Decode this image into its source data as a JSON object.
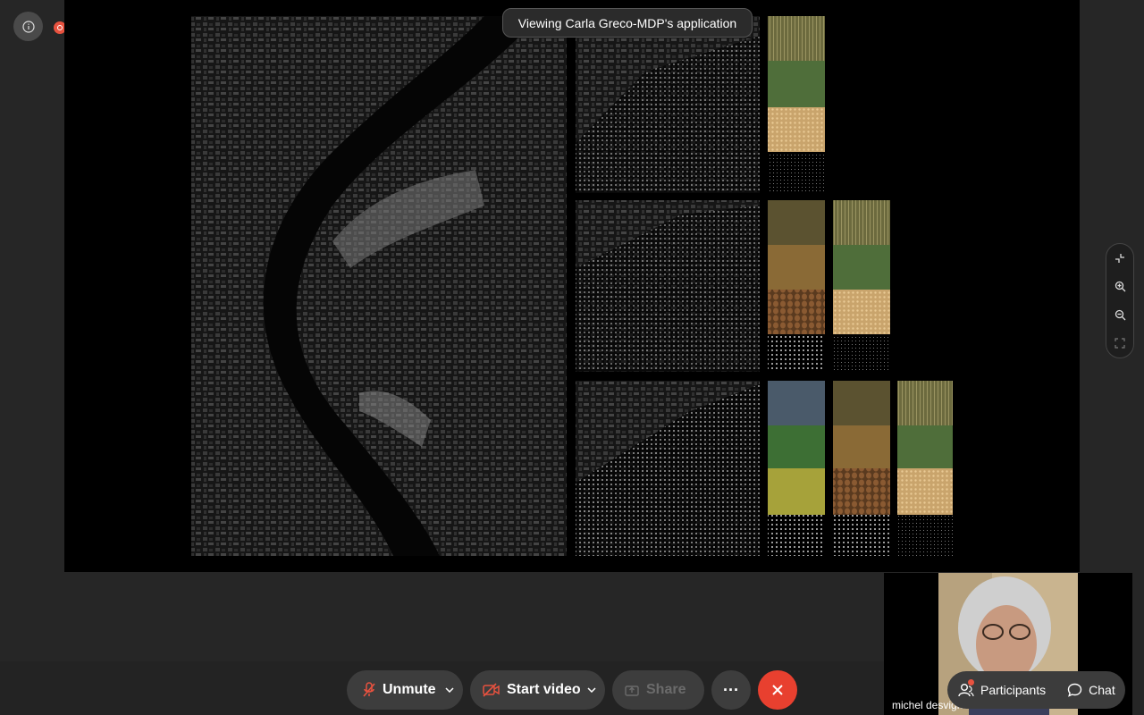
{
  "banner": {
    "text": "Viewing Carla Greco-MDP's application"
  },
  "toolbar": {
    "unmute_label": "Unmute",
    "start_video_label": "Start video",
    "share_label": "Share",
    "more_label": "···"
  },
  "side_dock": {
    "participants_label": "Participants",
    "chat_label": "Chat"
  },
  "self_view": {
    "name": "michel desvigne"
  },
  "colors": {
    "recording": "#e8523f",
    "end_call": "#e8402f",
    "pill_bg": "#3d3d3d",
    "unmute_icon": "#e8523f",
    "video_icon": "#e8523f"
  },
  "icons": {
    "info": "info-icon",
    "mic_muted": "microphone-muted-icon",
    "video_off": "video-off-icon",
    "share": "share-icon",
    "end": "close-icon",
    "participants": "participants-icon",
    "chat": "chat-icon",
    "collapse": "collapse-icon",
    "zoom_in": "zoom-in-icon",
    "zoom_out": "zoom-out-icon",
    "fit": "fit-screen-icon"
  }
}
